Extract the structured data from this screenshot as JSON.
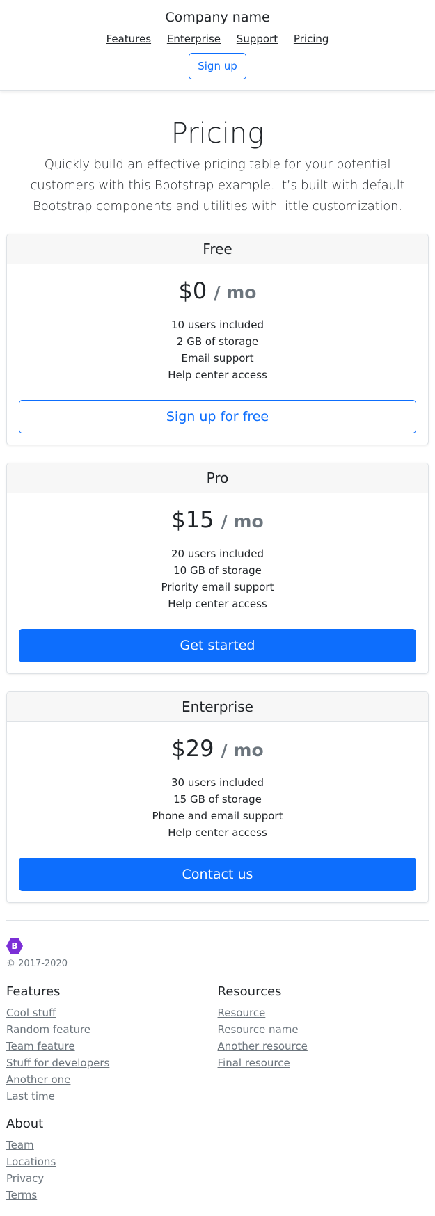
{
  "header": {
    "brand": "Company name",
    "nav": [
      "Features",
      "Enterprise",
      "Support",
      "Pricing"
    ],
    "signup": "Sign up"
  },
  "hero": {
    "title": "Pricing",
    "lead": "Quickly build an effective pricing table for your potential customers with this Bootstrap example. It’s built with default Bootstrap components and utilities with little customization."
  },
  "plans": [
    {
      "name": "Free",
      "price": "$0",
      "period": "/ mo",
      "features": [
        "10 users included",
        "2 GB of storage",
        "Email support",
        "Help center access"
      ],
      "button": "Sign up for free"
    },
    {
      "name": "Pro",
      "price": "$15",
      "period": "/ mo",
      "features": [
        "20 users included",
        "10 GB of storage",
        "Priority email support",
        "Help center access"
      ],
      "button": "Get started"
    },
    {
      "name": "Enterprise",
      "price": "$29",
      "period": "/ mo",
      "features": [
        "30 users included",
        "15 GB of storage",
        "Phone and email support",
        "Help center access"
      ],
      "button": "Contact us"
    }
  ],
  "footer": {
    "logo_letter": "B",
    "copyright": "© 2017-2020",
    "features": {
      "title": "Features",
      "links": [
        "Cool stuff",
        "Random feature",
        "Team feature",
        "Stuff for developers",
        "Another one",
        "Last time"
      ]
    },
    "resources": {
      "title": "Resources",
      "links": [
        "Resource",
        "Resource name",
        "Another resource",
        "Final resource"
      ]
    },
    "about": {
      "title": "About",
      "links": [
        "Team",
        "Locations",
        "Privacy",
        "Terms"
      ]
    }
  },
  "colors": {
    "primary": "#0d6efd",
    "muted": "#6c757d",
    "brand_logo": "#7b2fd6"
  }
}
